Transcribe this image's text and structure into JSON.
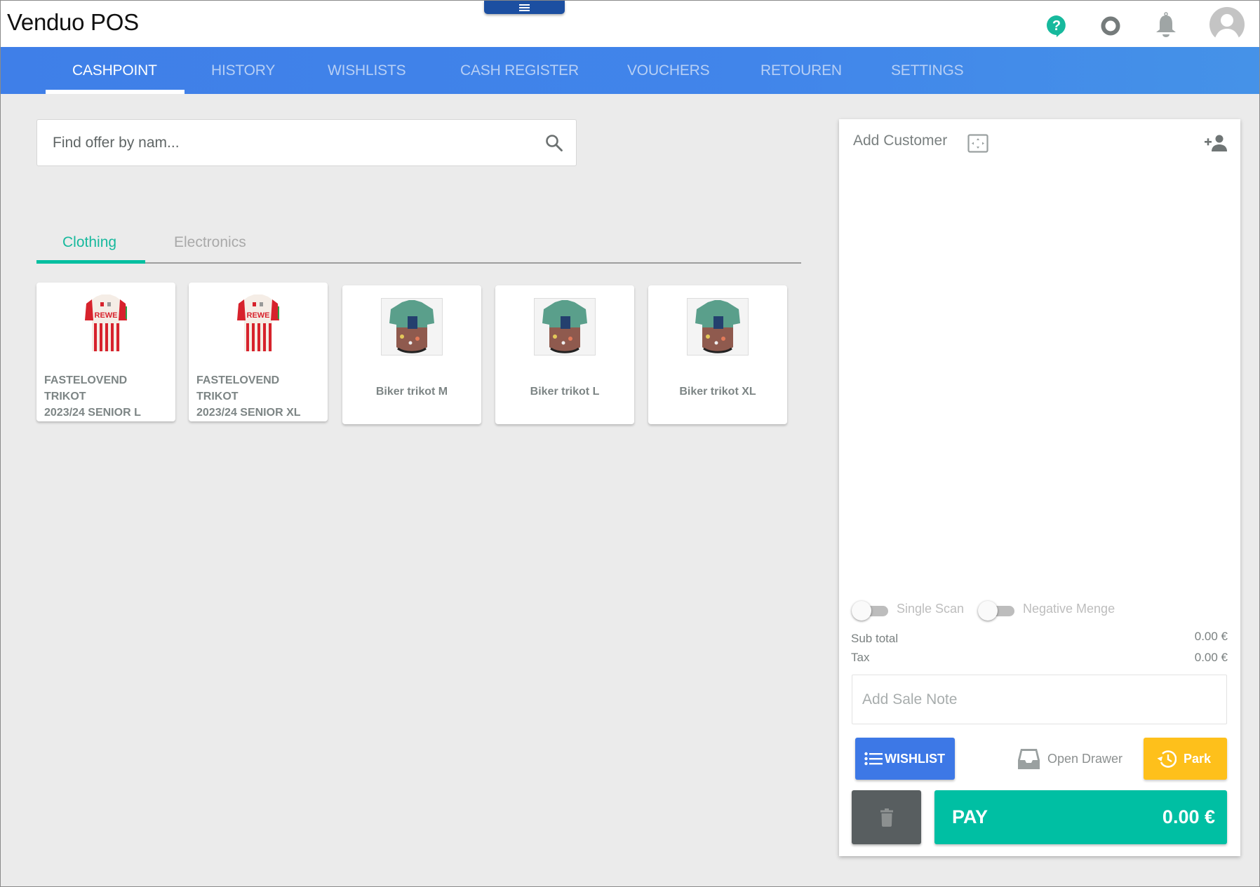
{
  "app": {
    "title": "Venduo POS",
    "menu_handle_icon": "hamburger-icon",
    "header_icons": [
      "help-icon",
      "status-ring-icon",
      "notification-bell-icon",
      "user-avatar-icon"
    ]
  },
  "nav": {
    "tabs": [
      {
        "label": "CASHPOINT",
        "active": true
      },
      {
        "label": "HISTORY",
        "active": false
      },
      {
        "label": "WISHLISTS",
        "active": false
      },
      {
        "label": "CASH REGISTER",
        "active": false
      },
      {
        "label": "VOUCHERS",
        "active": false
      },
      {
        "label": "RETOUREN",
        "active": false
      },
      {
        "label": "SETTINGS",
        "active": false
      }
    ]
  },
  "search": {
    "placeholder": "Find offer by nam...",
    "value": "",
    "icon": "search-icon"
  },
  "categories": {
    "tabs": [
      {
        "label": "Clothing",
        "active": true
      },
      {
        "label": "Electronics",
        "active": false
      }
    ]
  },
  "products": [
    {
      "name_line1": "FASTELOVEND TRIKOT",
      "name_line2": "2023/24 SENIOR L",
      "image": "football-jersey-red-white"
    },
    {
      "name_line1": "FASTELOVEND TRIKOT",
      "name_line2": "2023/24 SENIOR XL",
      "image": "football-jersey-red-white"
    },
    {
      "name_line1": "Biker trikot M",
      "name_line2": "",
      "image": "cycling-jersey-teal"
    },
    {
      "name_line1": "Biker trikot L",
      "name_line2": "",
      "image": "cycling-jersey-teal"
    },
    {
      "name_line1": "Biker trikot XL",
      "name_line2": "",
      "image": "cycling-jersey-teal"
    }
  ],
  "cart": {
    "add_customer_label": "Add Customer",
    "toggles": [
      {
        "label": "Single Scan",
        "on": false
      },
      {
        "label": "Negative Menge",
        "on": false
      }
    ],
    "subtotal_label": "Sub total",
    "subtotal_value": "0.00 €",
    "tax_label": "Tax",
    "tax_value": "0.00 €",
    "sale_note_placeholder": "Add Sale Note",
    "wishlist_button": "WISHLIST",
    "open_drawer_button": "Open Drawer",
    "park_button": "Park",
    "pay_label": "PAY",
    "pay_amount": "0.00 €"
  },
  "colors": {
    "nav_bg": "#4185ea",
    "accent_teal": "#00bfa3",
    "wishlist_blue": "#3d78e6",
    "park_yellow": "#fec01b",
    "trash_gray": "#585e60",
    "menu_handle": "#1c4fa1"
  }
}
